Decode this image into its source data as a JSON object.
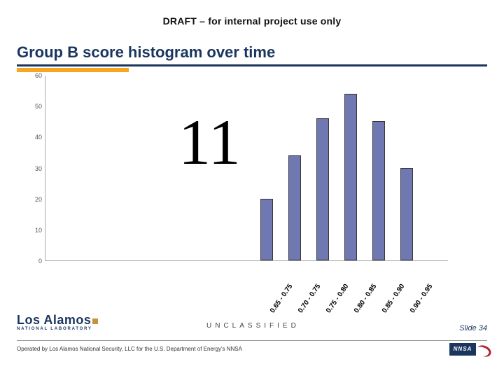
{
  "header": {
    "draft_line": "DRAFT – for internal project use only",
    "title": "Group B score histogram over time"
  },
  "overlay": {
    "big_number": "11"
  },
  "footer": {
    "classification": "UNCLASSIFIED",
    "slide_label": "Slide 34",
    "operated_by": "Operated by Los Alamos National Security, LLC for the U.S. Department of Energy's NNSA",
    "lab_name_top": "Los Alamos",
    "lab_name_bot": "NATIONAL LABORATORY",
    "nnsa": "NNSA"
  },
  "chart_data": {
    "type": "bar",
    "title": "Group B score histogram over time",
    "xlabel": "",
    "ylabel": "",
    "ylim": [
      0,
      60
    ],
    "y_ticks": [
      0,
      10,
      20,
      30,
      40,
      50,
      60
    ],
    "categories": [
      "0.65 - 0.75",
      "0.70 - 0.75",
      "0.75 - 0.80",
      "0.80 - 0.85",
      "0.85 - 0.90",
      "0.90 - 0.95"
    ],
    "values": [
      20,
      34,
      46,
      54,
      45,
      30
    ]
  }
}
